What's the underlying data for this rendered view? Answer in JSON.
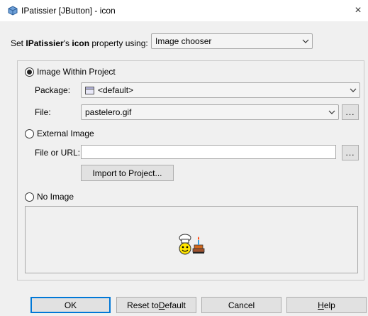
{
  "window": {
    "title": "IPatissier [JButton] - icon",
    "icon": "netbeans-cube-icon",
    "close_symbol": "×"
  },
  "header": {
    "prefix": "Set ",
    "component": "IPatissier",
    "middle": "'s ",
    "property": "icon",
    "suffix": " property using:",
    "mode_value": "Image chooser"
  },
  "options": {
    "within_project_label": "Image Within Project",
    "package_label": "Package:",
    "package_value": "<default>",
    "file_label": "File:",
    "file_value": "pastelero.gif",
    "browse_label": "...",
    "external_label": "External Image",
    "url_label": "File or URL:",
    "url_value": "",
    "url_browse_label": "...",
    "import_label": "Import to Project...",
    "no_image_label": "No Image"
  },
  "preview": {
    "icon": "pastry-chef-icon"
  },
  "footer": {
    "ok_label": "OK",
    "reset_prefix": "Reset to ",
    "reset_mnemonic": "D",
    "reset_suffix": "efault",
    "cancel_label": "Cancel",
    "help_mnemonic": "H",
    "help_suffix": "elp"
  },
  "colors": {
    "accent": "#0078d7",
    "dialog_bg": "#f0f0f0"
  }
}
